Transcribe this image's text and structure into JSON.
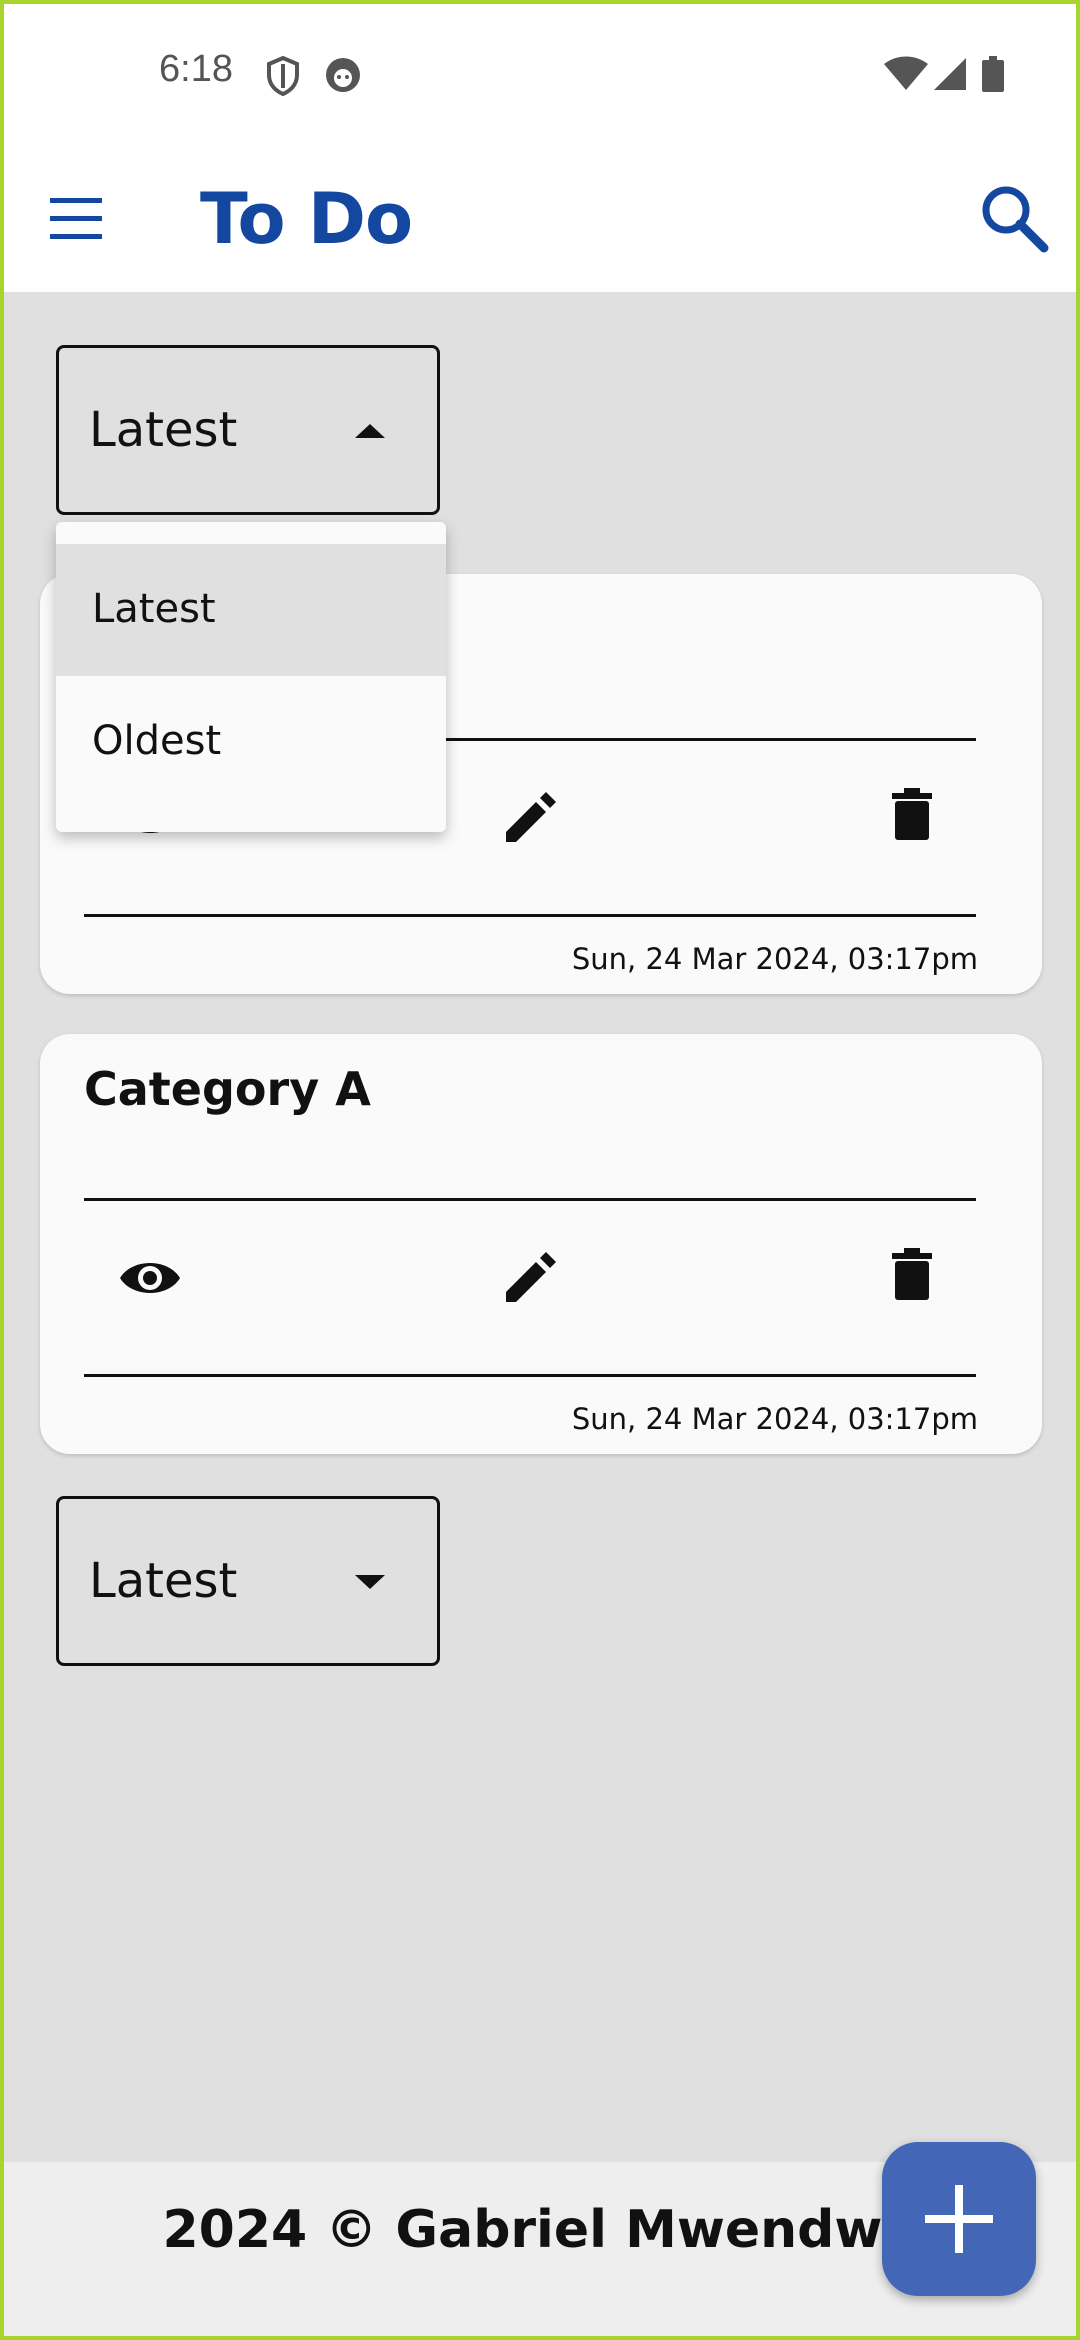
{
  "status_bar": {
    "time": "6:18",
    "icons": [
      "shield-icon",
      "face-icon",
      "wifi-icon",
      "signal-icon",
      "battery-icon"
    ]
  },
  "app_bar": {
    "title": "To Do",
    "title_color": "#1447a0",
    "menu_icon": "menu-icon",
    "search_icon": "search-icon"
  },
  "sort_top": {
    "selected": "Latest",
    "state": "open",
    "options": [
      "Latest",
      "Oldest"
    ],
    "highlighted": "Latest"
  },
  "cards": [
    {
      "title": "",
      "date": "Sun, 24 Mar 2024, 03:17pm",
      "actions": [
        "eye-icon",
        "edit-icon",
        "delete-icon"
      ]
    },
    {
      "title": "Category A",
      "date": "Sun, 24 Mar 2024, 03:17pm",
      "actions": [
        "eye-icon",
        "edit-icon",
        "delete-icon"
      ]
    }
  ],
  "sort_bottom": {
    "selected": "Latest",
    "state": "closed"
  },
  "footer": {
    "text": "2024 © Gabriel Mwendwa"
  },
  "fab": {
    "icon": "plus-icon",
    "color": "#4366b6"
  }
}
